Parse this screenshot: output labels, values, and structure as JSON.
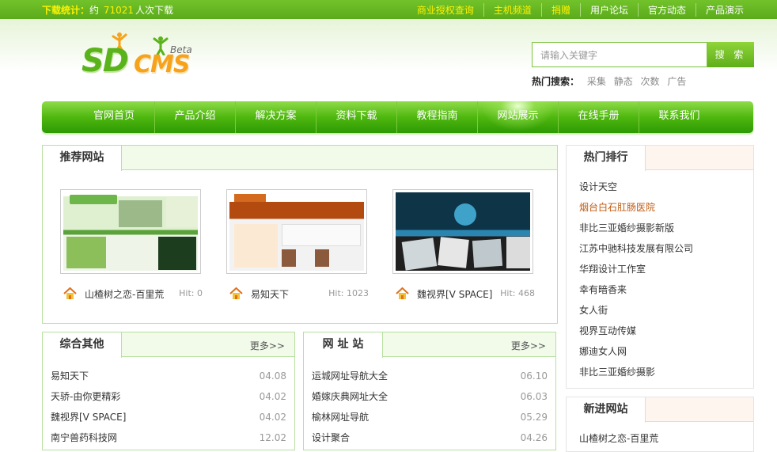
{
  "topbar": {
    "stats_label": "下载统计：",
    "stats_prefix": "约",
    "stats_count": "71021",
    "stats_suffix": "人次下载",
    "links": [
      "商业授权查询",
      "主机频道",
      "捐赠",
      "用户论坛",
      "官方动态",
      "产品演示"
    ]
  },
  "logo": {
    "main": "SD",
    "sub": "CMS",
    "badge": "Beta"
  },
  "search": {
    "placeholder": "请输入关键字",
    "button": "搜 索",
    "hot_label": "热门搜索：",
    "hot_terms": [
      "采集",
      "静态",
      "次数",
      "广告"
    ]
  },
  "nav": {
    "items": [
      "官网首页",
      "产品介绍",
      "解决方案",
      "资料下载",
      "教程指南",
      "网站展示",
      "在线手册",
      "联系我们"
    ],
    "active_index": 5
  },
  "recommended": {
    "title": "推荐网站",
    "sites": [
      {
        "name": "山楂树之恋-百里荒",
        "hit": "Hit: 0"
      },
      {
        "name": "易知天下",
        "hit": "Hit: 1023"
      },
      {
        "name": "魏视界[V SPACE]",
        "hit": "Hit: 468"
      }
    ]
  },
  "misc": {
    "title": "综合其他",
    "more": "更多>>",
    "items": [
      {
        "name": "易知天下",
        "date": "04.08"
      },
      {
        "name": "天骄-由你更精彩",
        "date": "04.02"
      },
      {
        "name": "魏视界[V SPACE]",
        "date": "04.02"
      },
      {
        "name": "南宁兽药科技网",
        "date": "12.02"
      }
    ]
  },
  "urls": {
    "title": "网 址 站",
    "more": "更多>>",
    "items": [
      {
        "name": "运城网址导航大全",
        "date": "06.10"
      },
      {
        "name": "婚嫁庆典网址大全",
        "date": "06.03"
      },
      {
        "name": "榆林网址导航",
        "date": "05.29"
      },
      {
        "name": "设计聚合",
        "date": "04.26"
      }
    ]
  },
  "hot_rank": {
    "title": "热门排行",
    "items": [
      "设计天空",
      "烟台白石肛肠医院",
      "非比三亚婚纱摄影新版",
      "江苏中驰科技发展有限公司",
      "华翔设计工作室",
      "幸有暗香来",
      "女人街",
      "视界互动传媒",
      "娜迪女人网",
      "非比三亚婚纱摄影"
    ],
    "highlight_index": 1
  },
  "new_sites": {
    "title": "新进网站",
    "items": [
      "山楂树之恋-百里荒"
    ]
  },
  "colors": {
    "brand_green": "#5bab1c",
    "accent_yellow": "#fff200",
    "highlight_orange": "#c05a10"
  }
}
